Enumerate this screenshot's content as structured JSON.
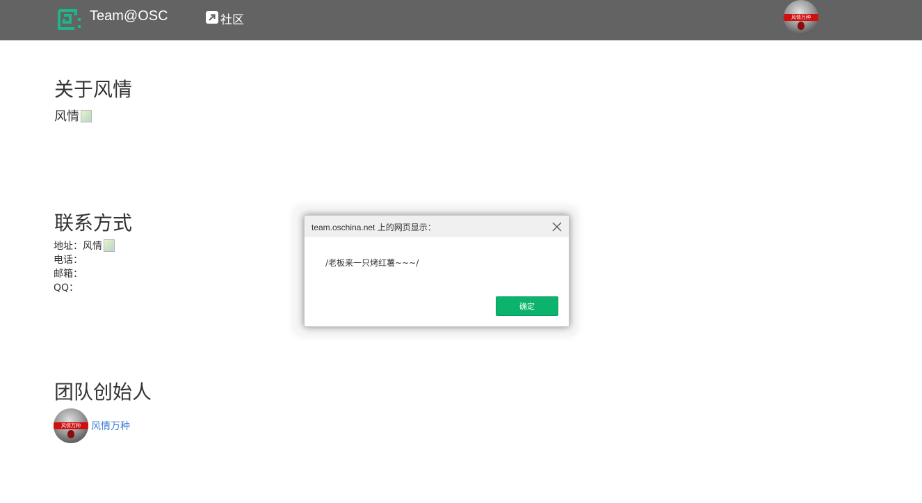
{
  "header": {
    "brand": "Team@OSC",
    "community_label": "社区",
    "user_avatar_caption": "风情万种"
  },
  "about": {
    "title": "关于风情",
    "text": "风情"
  },
  "contact": {
    "title": "联系方式",
    "address_label": "地址：",
    "address_value": "风情",
    "phone_label": "电话：",
    "email_label": "邮箱：",
    "qq_label": "QQ："
  },
  "founders": {
    "title": "团队创始人",
    "name": "风情万种",
    "avatar_caption": "风情万种"
  },
  "dialog": {
    "title": "team.oschina.net 上的网页显示：",
    "message": "/老板来一只烤红薯~~~/",
    "ok_label": "确定"
  },
  "colors": {
    "topbar": "#636363",
    "logo": "#1fb58c",
    "link": "#3c7bd1",
    "ok_button": "#0cb36c"
  }
}
